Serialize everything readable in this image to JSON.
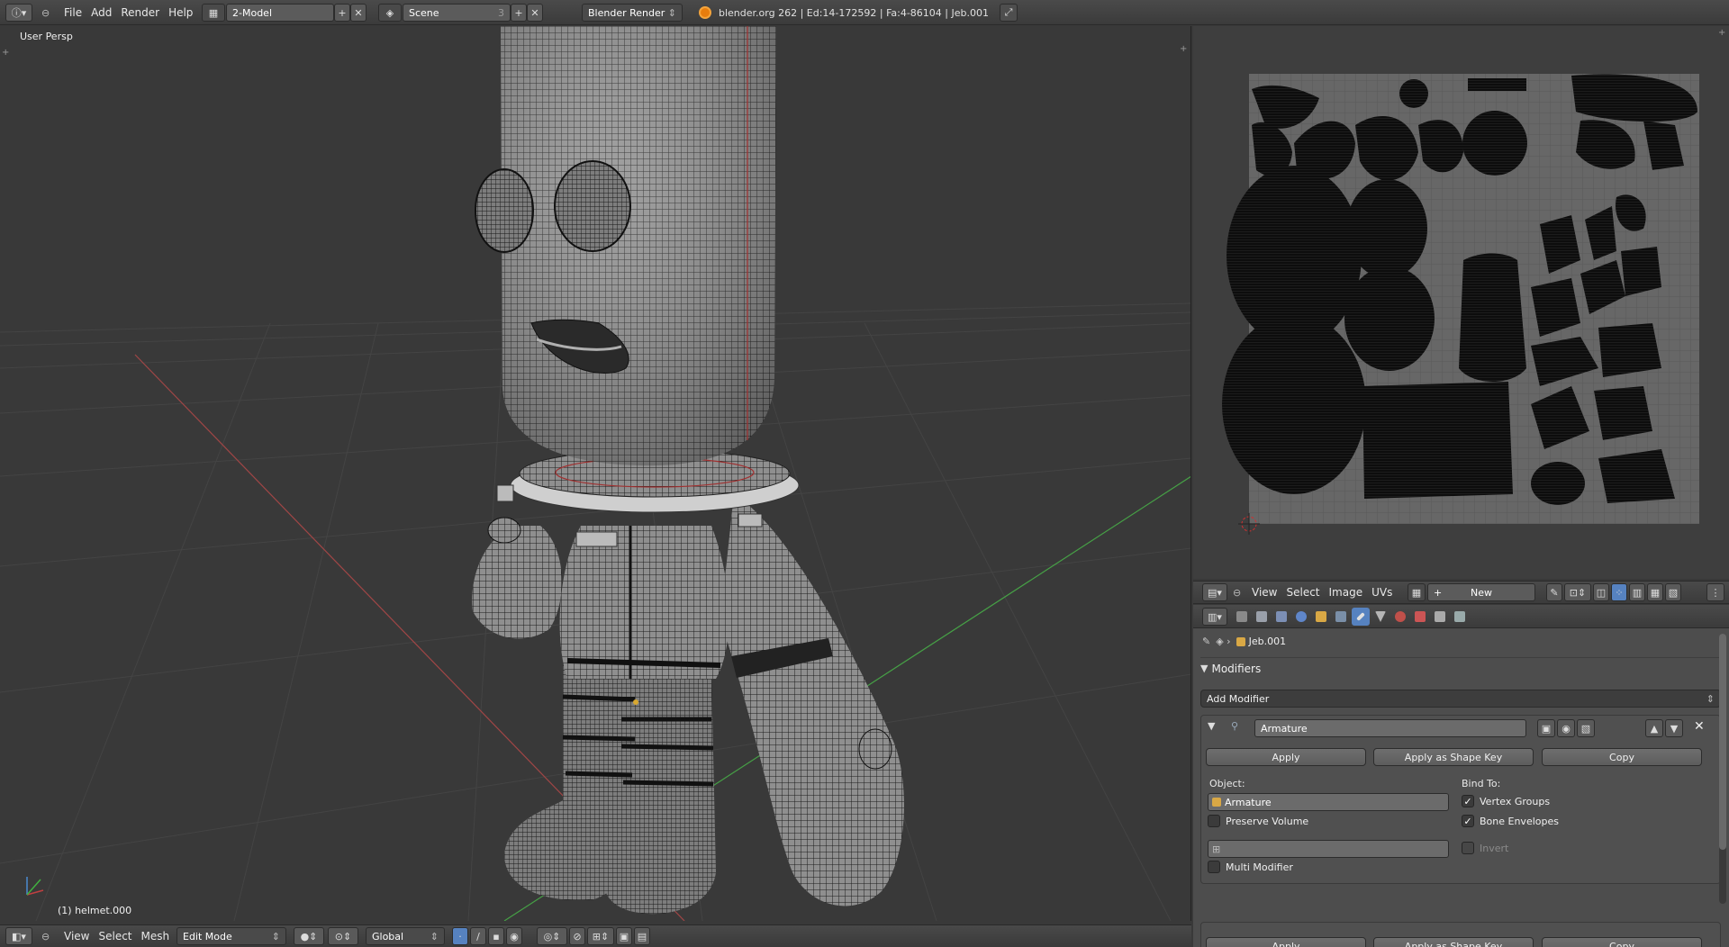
{
  "top_header": {
    "menus": [
      "File",
      "Add",
      "Render",
      "Help"
    ],
    "screen_layout": "2-Model",
    "scene": "Scene",
    "scene_users": "3",
    "render_engine": "Blender Render",
    "stats": "blender.org 262 | Ed:14-172592 | Fa:4-86104 | Jeb.001"
  },
  "viewport": {
    "view_label": "User Persp",
    "object_label": "(1) helmet.000"
  },
  "viewport_header": {
    "menus": [
      "View",
      "Select",
      "Mesh"
    ],
    "mode": "Edit Mode",
    "orientation": "Global"
  },
  "uv_header": {
    "menus": [
      "View",
      "Select",
      "Image",
      "UVs"
    ],
    "new_label": "New"
  },
  "properties": {
    "breadcrumb_object": "Jeb.001",
    "panel_title": "Modifiers",
    "add_modifier": "Add Modifier",
    "modifier": {
      "name": "Armature",
      "apply": "Apply",
      "apply_shape": "Apply as Shape Key",
      "copy": "Copy",
      "object_label": "Object:",
      "object_value": "Armature",
      "bind_to_label": "Bind To:",
      "vertex_groups": "Vertex Groups",
      "vertex_groups_checked": true,
      "bone_envelopes": "Bone Envelopes",
      "bone_envelopes_checked": true,
      "preserve_volume": "Preserve Volume",
      "preserve_volume_checked": false,
      "invert": "Invert",
      "multi_modifier": "Multi Modifier",
      "multi_modifier_checked": false
    },
    "second_modifier": {
      "apply": "Apply",
      "apply_shape": "Apply as Shape Key",
      "copy": "Copy"
    }
  },
  "colors": {
    "background": "#393939",
    "active_tab": "#5682c0",
    "x_axis": "#b04a4a",
    "y_axis": "#4aa84a",
    "wire": "#1a1a1a",
    "mesh_surface": "#9a9a9a"
  },
  "icons": [
    "info-icon",
    "screen-layout-icon",
    "scene-icon",
    "blender-logo-icon",
    "fullscreen-icon",
    "cursor-3d-icon",
    "modifier-wrench-icon",
    "armature-icon",
    "checkmark-icon"
  ]
}
